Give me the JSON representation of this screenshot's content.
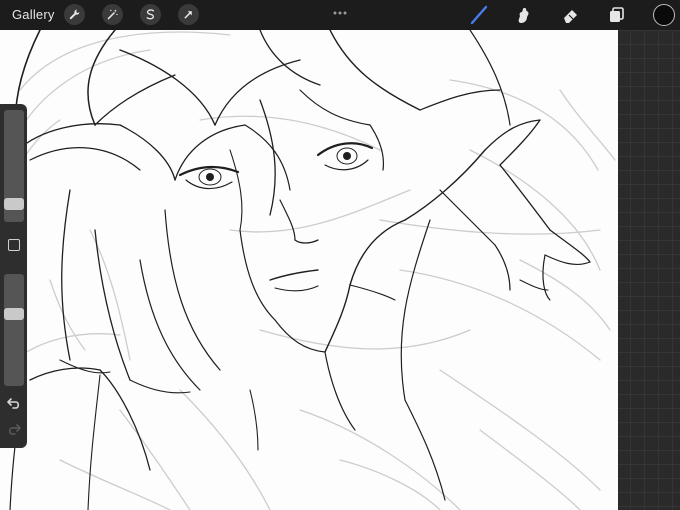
{
  "topbar": {
    "gallery_label": "Gallery",
    "left_tools": [
      "wrench-icon",
      "magic-wand-icon",
      "selection-icon",
      "transform-arrow-icon"
    ],
    "right_tools": [
      "brush-icon",
      "smudge-icon",
      "eraser-icon",
      "layers-icon"
    ],
    "active_tool": "brush-icon",
    "accent_color": "#4a7cf0",
    "current_color": "#0a0a0a"
  },
  "sidebar": {
    "brush_size_level": 0.72,
    "opacity_level": 0.34
  }
}
